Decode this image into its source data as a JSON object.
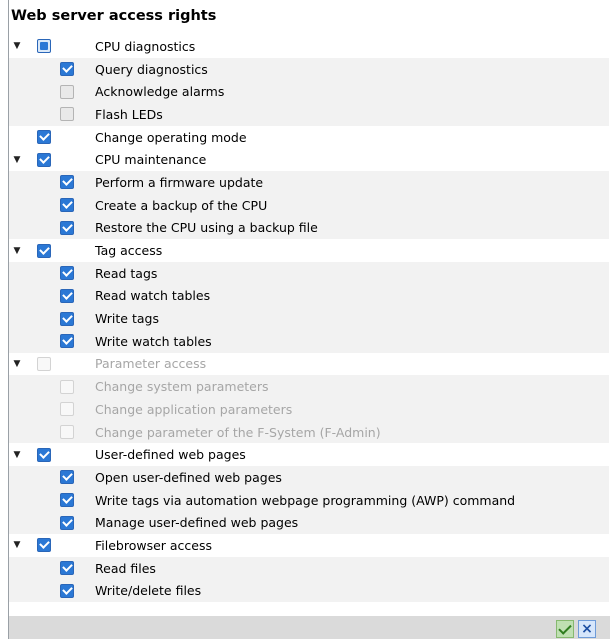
{
  "title": "Web server access rights",
  "items": [
    {
      "label": "CPU diagnostics",
      "level": 0,
      "state": "partial",
      "expanded": true
    },
    {
      "label": "Query diagnostics",
      "level": 1,
      "state": "checked"
    },
    {
      "label": "Acknowledge alarms",
      "level": 1,
      "state": "unchecked"
    },
    {
      "label": "Flash LEDs",
      "level": 1,
      "state": "unchecked"
    },
    {
      "label": "Change operating mode",
      "level": 0,
      "state": "checked",
      "expanded": false
    },
    {
      "label": "CPU maintenance",
      "level": 0,
      "state": "checked",
      "expanded": true
    },
    {
      "label": "Perform a firmware update",
      "level": 1,
      "state": "checked"
    },
    {
      "label": "Create a backup of the CPU",
      "level": 1,
      "state": "checked"
    },
    {
      "label": "Restore the CPU using a backup file",
      "level": 1,
      "state": "checked"
    },
    {
      "label": "Tag access",
      "level": 0,
      "state": "checked",
      "expanded": true
    },
    {
      "label": "Read tags",
      "level": 1,
      "state": "checked"
    },
    {
      "label": "Read watch tables",
      "level": 1,
      "state": "checked"
    },
    {
      "label": "Write tags",
      "level": 1,
      "state": "checked"
    },
    {
      "label": "Write watch tables",
      "level": 1,
      "state": "checked"
    },
    {
      "label": "Parameter access",
      "level": 0,
      "state": "disabled",
      "expanded": true
    },
    {
      "label": "Change system parameters",
      "level": 1,
      "state": "disabled"
    },
    {
      "label": "Change application parameters",
      "level": 1,
      "state": "disabled"
    },
    {
      "label": "Change parameter of the F-System (F-Admin)",
      "level": 1,
      "state": "disabled"
    },
    {
      "label": "User-defined web pages",
      "level": 0,
      "state": "checked",
      "expanded": true
    },
    {
      "label": "Open user-defined web pages",
      "level": 1,
      "state": "checked"
    },
    {
      "label": "Write tags via automation webpage programming (AWP) command",
      "level": 1,
      "state": "checked"
    },
    {
      "label": "Manage user-defined web pages",
      "level": 1,
      "state": "checked"
    },
    {
      "label": "Filebrowser access",
      "level": 0,
      "state": "checked",
      "expanded": true
    },
    {
      "label": "Read files",
      "level": 1,
      "state": "checked"
    },
    {
      "label": "Write/delete files",
      "level": 1,
      "state": "checked"
    }
  ]
}
